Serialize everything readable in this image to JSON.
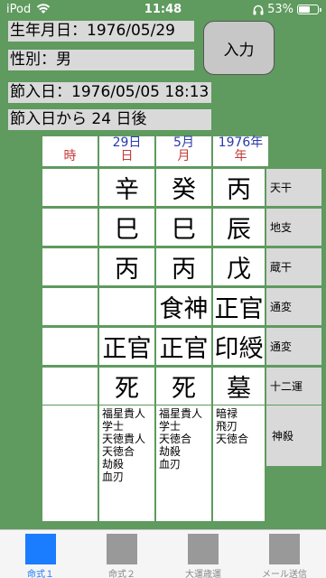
{
  "status": {
    "carrier": "iPod",
    "time": "11:48",
    "battery": "53%"
  },
  "info": {
    "birth": "生年月日：1976/05/29",
    "gender": "性別：男",
    "setsu": "節入日：1976/05/05 18:13",
    "days": "節入日から 24 日後"
  },
  "input_button": "入力",
  "columns": {
    "top": [
      "29日",
      "5月",
      "1976年"
    ],
    "bottom": [
      "時",
      "日",
      "月",
      "年"
    ]
  },
  "rows": [
    {
      "cells": [
        "",
        "辛",
        "癸",
        "丙"
      ],
      "label": "天干"
    },
    {
      "cells": [
        "",
        "巳",
        "巳",
        "辰"
      ],
      "label": "地支"
    },
    {
      "cells": [
        "",
        "丙",
        "丙",
        "戊"
      ],
      "label": "蔵干"
    },
    {
      "cells": [
        "",
        "",
        "食神",
        "正官"
      ],
      "label": "通変"
    },
    {
      "cells": [
        "",
        "正官",
        "正官",
        "印綬"
      ],
      "label": "通変"
    },
    {
      "cells": [
        "",
        "死",
        "死",
        "墓"
      ],
      "label": "十二運"
    }
  ],
  "shinsatsu": {
    "label": "神殺",
    "hour": "",
    "day": "福星貴人\n学士\n天徳貴人\n天徳合\n劫殺\n血刃",
    "month": "福星貴人\n学士\n天徳合\n劫殺\n血刃",
    "year": "暗禄\n飛刃\n天徳合"
  },
  "tabs": [
    "命式１",
    "命式２",
    "大運歳運",
    "メール送信"
  ],
  "colors": {
    "background": "#5f9a5f",
    "accent": "#1a7cff"
  }
}
